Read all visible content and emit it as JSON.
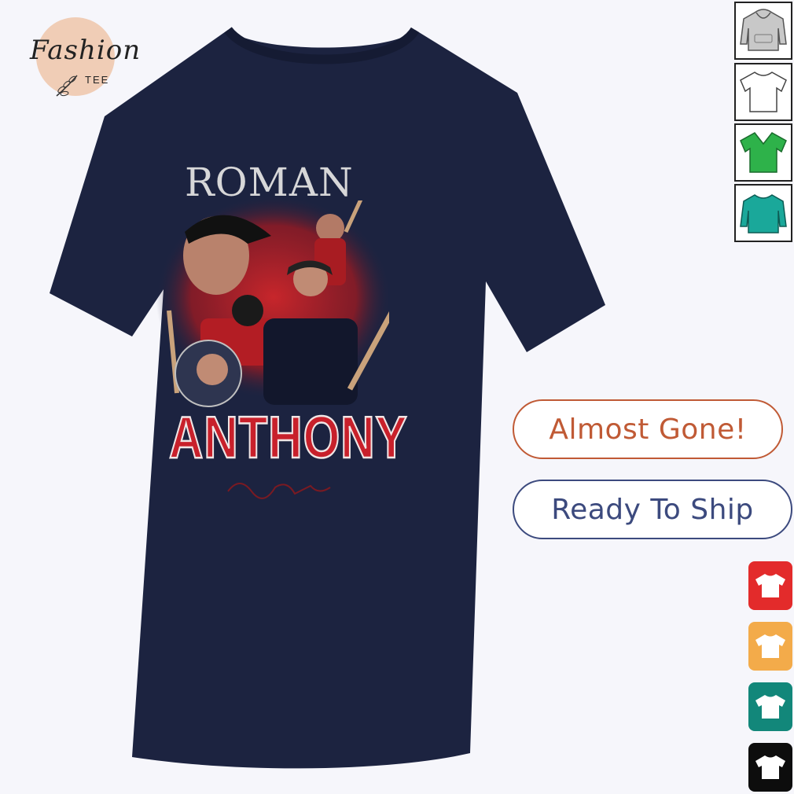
{
  "logo": {
    "script_text": "Fashion",
    "sub_text": "TEE",
    "icon": "leaf-icon"
  },
  "product": {
    "shirt_color": "#1c2340",
    "print": {
      "top_text": "ROMAN",
      "bottom_text": "ANTHONY",
      "accent_color": "#c8202b"
    }
  },
  "style_thumbnails": [
    {
      "icon": "hoodie-icon",
      "color": "#c8c8c8"
    },
    {
      "icon": "tshirt-icon",
      "color": "#ffffff"
    },
    {
      "icon": "vneck-icon",
      "color": "#2eb24a"
    },
    {
      "icon": "sweatshirt-icon",
      "color": "#1aa89a"
    }
  ],
  "badges": {
    "almost_gone": "Almost Gone!",
    "ready_to_ship": "Ready To Ship",
    "almost_gone_color": "#c05a35",
    "ready_to_ship_color": "#3c4a7e"
  },
  "color_swatches": [
    {
      "icon": "tshirt-icon",
      "color": "#e32b2b"
    },
    {
      "icon": "tshirt-icon",
      "color": "#f3ab4a"
    },
    {
      "icon": "tshirt-icon",
      "color": "#12877a"
    },
    {
      "icon": "tshirt-icon",
      "color": "#0d0d0d"
    }
  ]
}
